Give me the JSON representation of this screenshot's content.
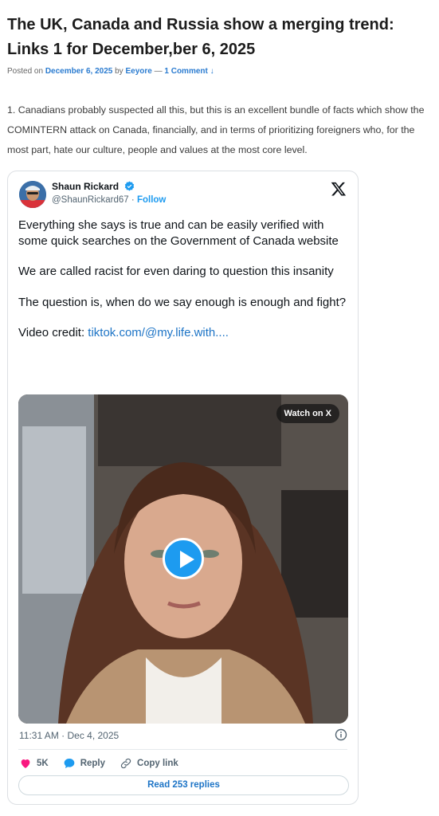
{
  "post": {
    "title": "The UK, Canada and Russia show a merging trend: Links 1 for December,ber 6, 2025",
    "meta_posted_on": "Posted on",
    "meta_date": "December 6, 2025",
    "meta_by": "by",
    "meta_author": "Eeyore",
    "meta_sep": "—",
    "meta_comments": "1 Comment ↓",
    "body": "1. Canadians probably suspected all this, but this is an excellent bundle of facts which show the COMINTERN attack on Canada, financially, and in terms of prioritizing foreigners who, for the most part, hate our culture, people and values at the most core level."
  },
  "tweet": {
    "author_name": "Shaun Rickard",
    "handle": "@ShaunRickard67",
    "dot": "·",
    "follow_label": "Follow",
    "paragraphs": [
      "Everything she says is true and can be easily verified with some quick searches on the Government of Canada website",
      "We are called racist for even daring to question this insanity",
      "The question is, when do we say enough is enough and fight?"
    ],
    "credit_prefix": "Video credit: ",
    "credit_link": "tiktok.com/@my.life.with....",
    "watch_label": "Watch on X",
    "timestamp": "11:31 AM · Dec 4, 2025",
    "likes": "5K",
    "reply_label": "Reply",
    "copy_label": "Copy link",
    "read_replies_label": "Read 253 replies"
  },
  "colors": {
    "link_blue": "#1d9bf0",
    "meta_blue": "#2a7bd0",
    "heart": "#f91880"
  },
  "icons": [
    "verified-badge-icon",
    "x-logo-icon",
    "play-icon",
    "info-icon",
    "heart-icon",
    "reply-bubble-icon",
    "link-icon"
  ]
}
